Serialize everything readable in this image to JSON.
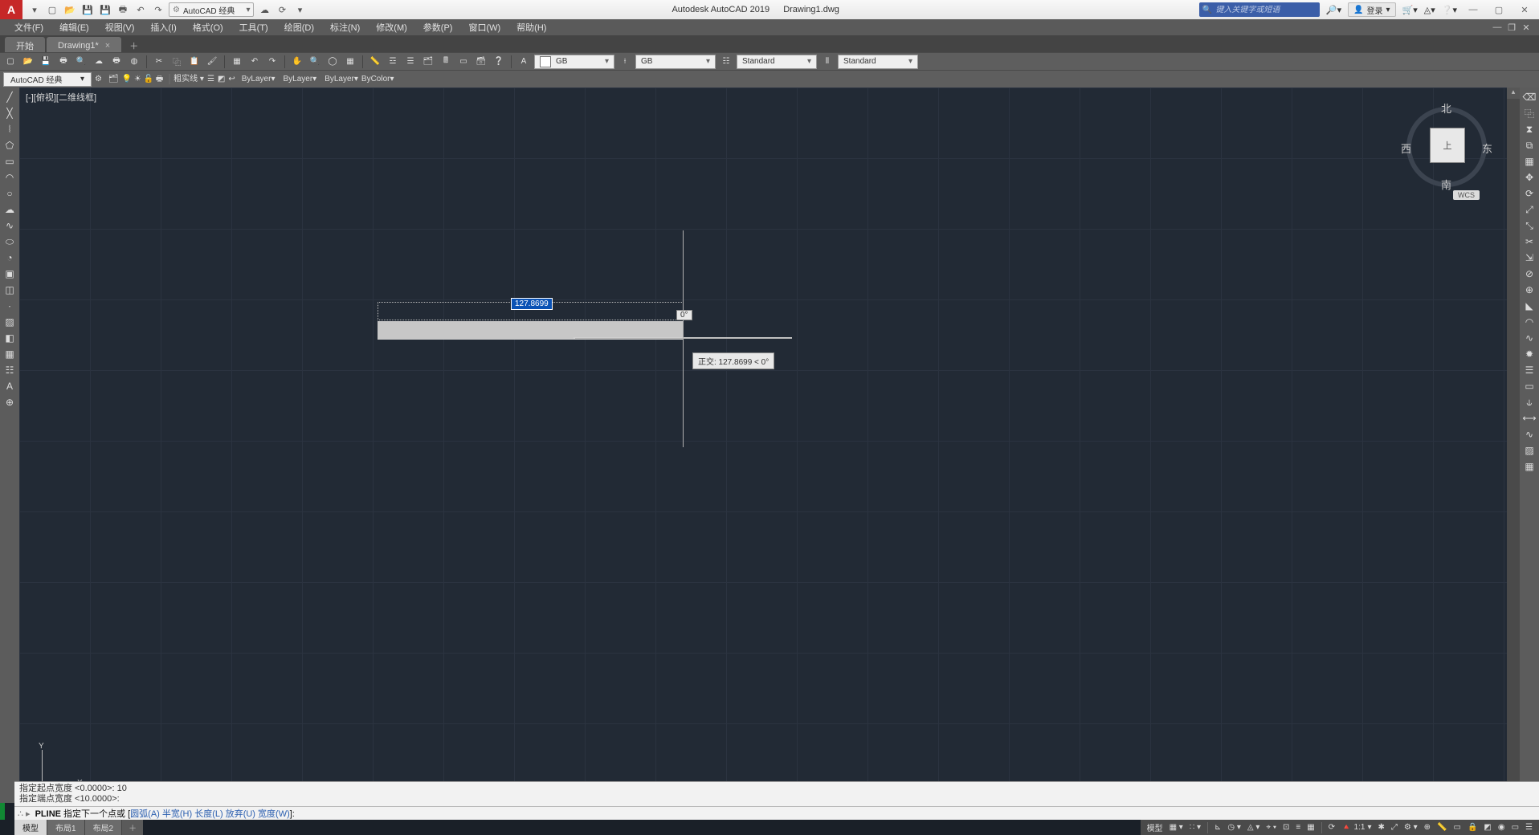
{
  "app": {
    "name": "Autodesk AutoCAD 2019",
    "document": "Drawing1.dwg"
  },
  "qat_workspace": "AutoCAD 经典",
  "search_placeholder": "键入关键字或短语",
  "login_label": "登录",
  "menus": [
    "文件(F)",
    "编辑(E)",
    "视图(V)",
    "插入(I)",
    "格式(O)",
    "工具(T)",
    "绘图(D)",
    "标注(N)",
    "修改(M)",
    "参数(P)",
    "窗口(W)",
    "帮助(H)"
  ],
  "ribbon": {
    "tabs": [
      "开始",
      "Drawing1*"
    ]
  },
  "toolbar": {
    "textstyle1": "GB",
    "textstyle2": "GB",
    "dimstyle": "Standard",
    "tablestyle": "Standard",
    "workspace_label": "AutoCAD 经典",
    "linetype_label": "粗实线",
    "prop_layer": "ByLayer",
    "prop_ltype": "ByLayer",
    "prop_lweight": "ByLayer",
    "prop_color": "ByColor"
  },
  "view": {
    "label": "[-][俯视][二维线框]",
    "wcs": "WCS",
    "cube_top": "上",
    "dir_n": "北",
    "dir_s": "南",
    "dir_e": "东",
    "dir_w": "西"
  },
  "drawing": {
    "dim_value": "127.8699",
    "angle_value": "0°",
    "tooltip": "正交: 127.8699 < 0°"
  },
  "ucs": {
    "x": "X",
    "y": "Y"
  },
  "command": {
    "hist1": "指定起点宽度 <0.0000>: 10",
    "hist2": "指定端点宽度 <10.0000>:",
    "prompt_cmd": "PLINE",
    "prompt_text": " 指定下一个点或 [",
    "opts": "圆弧(A) 半宽(H) 长度(L) 放弃(U) 宽度(W)",
    "prompt_tail": "]:"
  },
  "layout_tabs": [
    "模型",
    "布局1",
    "布局2"
  ],
  "status": {
    "model": "模型",
    "scale": "1:1",
    "ann_lock": "",
    "iso": "",
    "cursor": ""
  }
}
